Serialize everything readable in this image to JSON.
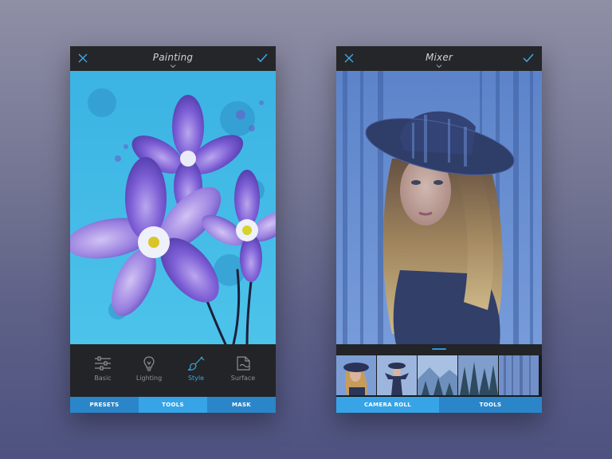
{
  "left_screen": {
    "title": "Painting",
    "tools": [
      {
        "label": "Basic",
        "icon": "sliders-icon",
        "active": false
      },
      {
        "label": "Lighting",
        "icon": "lightbulb-icon",
        "active": false
      },
      {
        "label": "Style",
        "icon": "brush-icon",
        "active": true
      },
      {
        "label": "Surface",
        "icon": "paper-texture-icon",
        "active": false
      }
    ],
    "tabs": [
      {
        "label": "PRESETS",
        "active": false
      },
      {
        "label": "TOOLS",
        "active": true
      },
      {
        "label": "MASK",
        "active": false
      }
    ]
  },
  "right_screen": {
    "title": "Mixer",
    "tabs": [
      {
        "label": "CAMERA ROLL",
        "active": true
      },
      {
        "label": "TOOLS",
        "active": false
      }
    ],
    "thumbnails": [
      "woman-hat-thumbnail",
      "woman-hat-arms-thumbnail",
      "mountain-pines-thumbnail",
      "pine-forest-thumbnail",
      "misty-forest-thumbnail"
    ]
  },
  "colors": {
    "accent": "#36a4e6",
    "tab_bar": "#2a86c9",
    "toolbar_bg": "#232427"
  }
}
